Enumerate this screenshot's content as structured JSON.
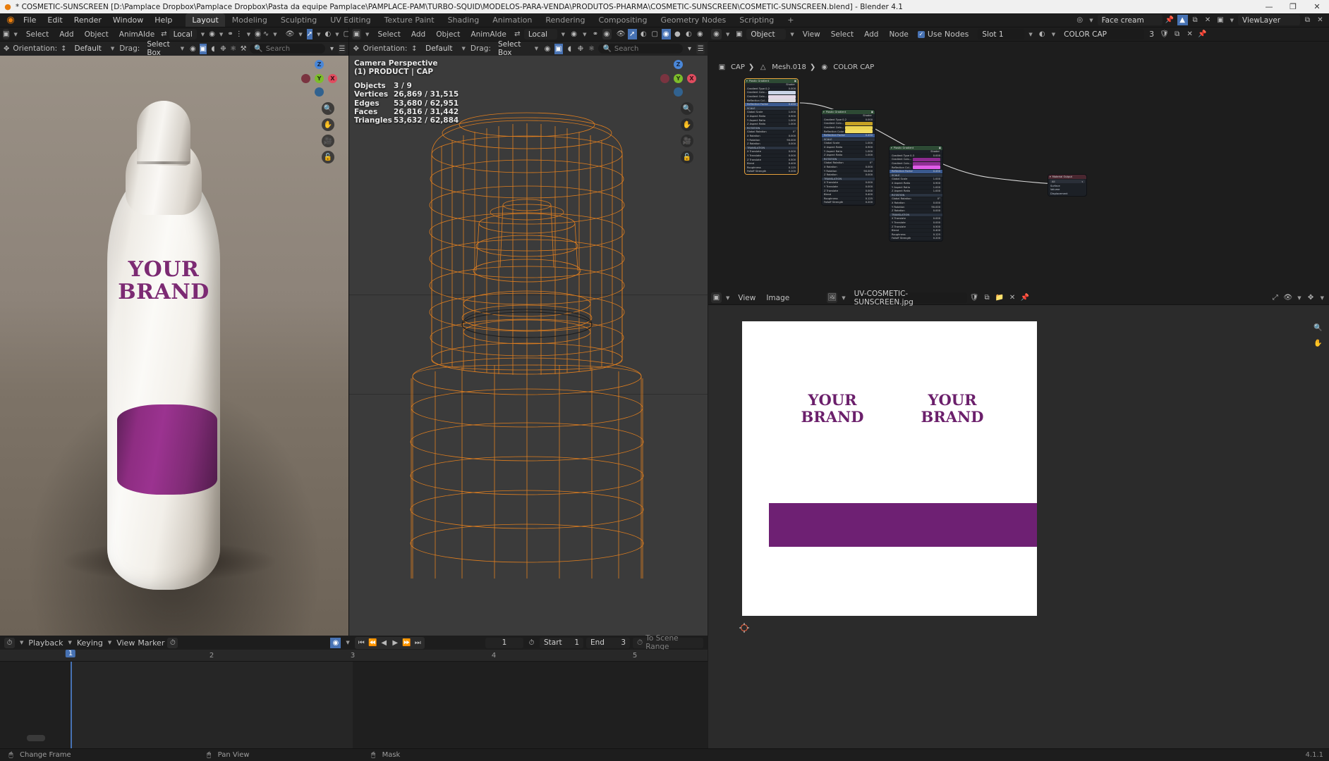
{
  "window": {
    "title": "* COSMETIC-SUNSCREEN [D:\\Pamplace Dropbox\\Pamplace Dropbox\\Pasta da equipe Pamplace\\PAMPLACE-PAM\\TURBO-SQUID\\MODELOS-PARA-VENDA\\PRODUTOS-PHARMA\\COSMETIC-SUNSCREEN\\COSMETIC-SUNSCREEN.blend] - Blender 4.1",
    "minimize": "—",
    "maximize": "❐",
    "close": "✕"
  },
  "topbar": {
    "logo_icon": "blender-logo-icon",
    "menus": [
      "File",
      "Edit",
      "Render",
      "Window",
      "Help"
    ],
    "workspace_tabs": [
      "Layout",
      "Modeling",
      "Sculpting",
      "UV Editing",
      "Texture Paint",
      "Shading",
      "Animation",
      "Rendering",
      "Compositing",
      "Geometry Nodes",
      "Scripting"
    ],
    "active_workspace": "Layout",
    "add_tab": "+",
    "scene_name": "Face cream",
    "view_layer_name": "ViewLayer"
  },
  "viewport_left": {
    "header": {
      "editor_icon": "editor-type-icon",
      "menus": [
        "Select",
        "Add",
        "Object",
        "AnimAIde"
      ],
      "transform_orientation": "Local",
      "shading_modes": [
        "wireframe",
        "solid",
        "material-preview",
        "rendered"
      ],
      "active_shading": "rendered"
    },
    "toolbar": {
      "orientation_label": "Orientation:",
      "orientation_value": "Default",
      "drag_label": "Drag:",
      "drag_value": "Select Box",
      "search_placeholder": "Search"
    },
    "render": {
      "brand_line1": "YOUR",
      "brand_line2": "BRAND",
      "band_color": "#8e2d82",
      "brand_text_color": "#7c2a73"
    },
    "gizmo_axes": [
      "Z",
      "Y",
      "X"
    ]
  },
  "viewport_mid": {
    "header": {
      "menus": [
        "Select",
        "Add",
        "Object",
        "AnimAIde"
      ],
      "transform_orientation": "Local"
    },
    "toolbar": {
      "orientation_label": "Orientation:",
      "orientation_value": "Default",
      "drag_label": "Drag:",
      "drag_value": "Select Box",
      "search_placeholder": "Search"
    },
    "overlay": {
      "view_name": "Camera Perspective",
      "active_object": "(1) PRODUCT | CAP",
      "stats": [
        {
          "label": "Objects",
          "value": "3 / 9"
        },
        {
          "label": "Vertices",
          "value": "26,869 / 31,515"
        },
        {
          "label": "Edges",
          "value": "53,680 / 62,951"
        },
        {
          "label": "Faces",
          "value": "26,816 / 31,442"
        },
        {
          "label": "Triangles",
          "value": "53,632 / 62,884"
        }
      ]
    },
    "gizmo_axes": [
      "Z",
      "Y",
      "X"
    ],
    "wire_color": "#e8821e"
  },
  "shader_editor": {
    "header": {
      "editor_icon": "shader-editor-icon",
      "shader_type": "Object",
      "menus": [
        "View",
        "Select",
        "Add",
        "Node"
      ],
      "use_nodes_label": "Use Nodes",
      "use_nodes_checked": true,
      "slot": "Slot 1",
      "material_name": "COLOR CAP",
      "material_users": "3"
    },
    "breadcrumb": [
      "CAP",
      "Mesh.018",
      "COLOR CAP"
    ],
    "nodes": [
      {
        "title": "Plastic Gradient",
        "selected": true,
        "output_label": "Shader",
        "accent": "#bfc6d6",
        "color_a": "#c9d3e6",
        "color_b": "#e3d7e6",
        "color_c": "#dcd9e0",
        "rows": [
          {
            "label": "Gradient Type 0-2",
            "value": "0.000"
          },
          {
            "label": "Gradient Colo...",
            "value": ""
          },
          {
            "label": "Gradient Colo...",
            "value": ""
          },
          {
            "label": "Reflection Col...",
            "value": ""
          },
          {
            "label": "Reflection Factor",
            "value": "0.450",
            "highlight": true
          },
          {
            "label": "SCALE",
            "section": true
          },
          {
            "label": "Global Scale",
            "value": "1.000"
          },
          {
            "label": "X Aspect Ratio",
            "value": "0.900"
          },
          {
            "label": "Y Aspect Ratio",
            "value": "1.000"
          },
          {
            "label": "Z Aspect Ratio",
            "value": "1.000"
          },
          {
            "label": "ROTATION",
            "section": true
          },
          {
            "label": "Global Rotation",
            "value": "0°"
          },
          {
            "label": "X Rotation",
            "value": "0.000"
          },
          {
            "label": "Y Rotation",
            "value": "90.000"
          },
          {
            "label": "Z Rotation",
            "value": "0.000"
          },
          {
            "label": "TRANSLATION",
            "section": true
          },
          {
            "label": "X Translate",
            "value": "0.000"
          },
          {
            "label": "Y Translate",
            "value": "0.000"
          },
          {
            "label": "Z Translate",
            "value": "0.500"
          },
          {
            "label": "Blend",
            "value": "0.400"
          },
          {
            "label": "Roughness",
            "value": "0.125"
          },
          {
            "label": "Falloff Strength",
            "value": "0.200"
          }
        ]
      },
      {
        "title": "Plastic Gradient",
        "selected": false,
        "output_label": "Shader",
        "color_a": "#c6a224",
        "color_b": "#ecd451",
        "color_c": "#f2dd63",
        "rows": [
          {
            "label": "Gradient Type 0-2",
            "value": "0.000"
          },
          {
            "label": "Gradient Colo...",
            "value": ""
          },
          {
            "label": "Gradient Colo...",
            "value": ""
          },
          {
            "label": "Reflection Color",
            "value": ""
          },
          {
            "label": "Reflection Factor",
            "value": "0.450",
            "highlight": true
          },
          {
            "label": "SCALE",
            "section": true
          },
          {
            "label": "Global Scale",
            "value": "1.000"
          },
          {
            "label": "X Aspect Ratio",
            "value": "0.900"
          },
          {
            "label": "Y Aspect Ratio",
            "value": "1.000"
          },
          {
            "label": "Z Aspect Ratio",
            "value": "1.000"
          },
          {
            "label": "ROTATION",
            "section": true
          },
          {
            "label": "Global Rotation",
            "value": "0°"
          },
          {
            "label": "X Rotation",
            "value": "0.000"
          },
          {
            "label": "Y Rotation",
            "value": "90.000"
          },
          {
            "label": "Z Rotation",
            "value": "0.000"
          },
          {
            "label": "TRANSLATION",
            "section": true
          },
          {
            "label": "X Translate",
            "value": "0.000"
          },
          {
            "label": "Y Translate",
            "value": "0.000"
          },
          {
            "label": "Z Translate",
            "value": "0.000"
          },
          {
            "label": "Blend",
            "value": "0.400"
          },
          {
            "label": "Roughness",
            "value": "0.125"
          },
          {
            "label": "Falloff Strength",
            "value": "0.200"
          }
        ]
      },
      {
        "title": "Plastic Gradient",
        "selected": false,
        "output_label": "Shader",
        "color_a": "#8b2a8e",
        "color_b": "#8f2f94",
        "color_c": "#e05de8",
        "rows": [
          {
            "label": "Gradient Type 0-3",
            "value": "0.000"
          },
          {
            "label": "Gradient Colo...",
            "value": ""
          },
          {
            "label": "Gradient Colo...",
            "value": ""
          },
          {
            "label": "Reflection Col...",
            "value": ""
          },
          {
            "label": "Reflection Factor",
            "value": "0.450",
            "highlight": true
          },
          {
            "label": "SCALE",
            "section": true
          },
          {
            "label": "Global Scale",
            "value": "1.000"
          },
          {
            "label": "X Aspect Ratio",
            "value": "0.900"
          },
          {
            "label": "Y Aspect Ratio",
            "value": "1.000"
          },
          {
            "label": "Z Aspect Ratio",
            "value": "1.000"
          },
          {
            "label": "ROTATION",
            "section": true
          },
          {
            "label": "Global Rotation",
            "value": "0°"
          },
          {
            "label": "X Rotation",
            "value": "0.000"
          },
          {
            "label": "Y Rotation",
            "value": "90.000"
          },
          {
            "label": "Z Rotation",
            "value": "0.000"
          },
          {
            "label": "TRANSLATION",
            "section": true
          },
          {
            "label": "X Translate",
            "value": "0.000"
          },
          {
            "label": "Y Translate",
            "value": "0.000"
          },
          {
            "label": "Z Translate",
            "value": "0.500"
          },
          {
            "label": "Blend",
            "value": "0.400"
          },
          {
            "label": "Roughness",
            "value": "0.125"
          },
          {
            "label": "Falloff Strength",
            "value": "0.200"
          }
        ]
      }
    ],
    "output_node": {
      "title": "Material Output",
      "target": "All",
      "inputs": [
        "Surface",
        "Volume",
        "Displacement"
      ]
    }
  },
  "image_editor": {
    "header": {
      "editor_icon": "image-editor-icon",
      "menus": [
        "View",
        "Image"
      ],
      "image_name": "UV-COSMETIC-SUNSCREEN.jpg",
      "fake_user_icon": "shield-icon",
      "new_icon": "new-image-icon",
      "open_icon": "open-folder-icon",
      "unlink_icon": "x-icon",
      "pin_icon": "pin-icon"
    },
    "uv_texture": {
      "label_left_line1": "YOUR",
      "label_left_line2": "BRAND",
      "label_right_line1": "YOUR",
      "label_right_line2": "BRAND",
      "text_color": "#6b1f6b",
      "bar_color": "#6e2073",
      "background": "#ffffff"
    }
  },
  "timeline": {
    "header": {
      "editor_icon": "timeline-icon",
      "menus": [
        "Playback",
        "Keying",
        "View",
        "Marker"
      ],
      "auto_key_icon": "auto-keying-icon",
      "playback_controls": [
        "jump-to-start",
        "jump-prev-keyframe",
        "play-reverse",
        "play",
        "jump-next-keyframe",
        "jump-to-end"
      ],
      "current_frame": "1",
      "start_label": "Start",
      "start_value": "1",
      "end_label": "End",
      "end_value": "3",
      "to_scene_range": "To Scene Range"
    },
    "ruler_ticks": [
      "1",
      "2",
      "3",
      "4",
      "5"
    ],
    "playhead_frame": "1"
  },
  "statusbar": {
    "items": [
      {
        "icon": "mouse-left-icon",
        "label": "Change Frame"
      },
      {
        "icon": "mouse-middle-icon",
        "label": "Pan View"
      },
      {
        "icon": "mouse-right-icon",
        "label": "Mask"
      }
    ],
    "version": "4.1.1"
  }
}
